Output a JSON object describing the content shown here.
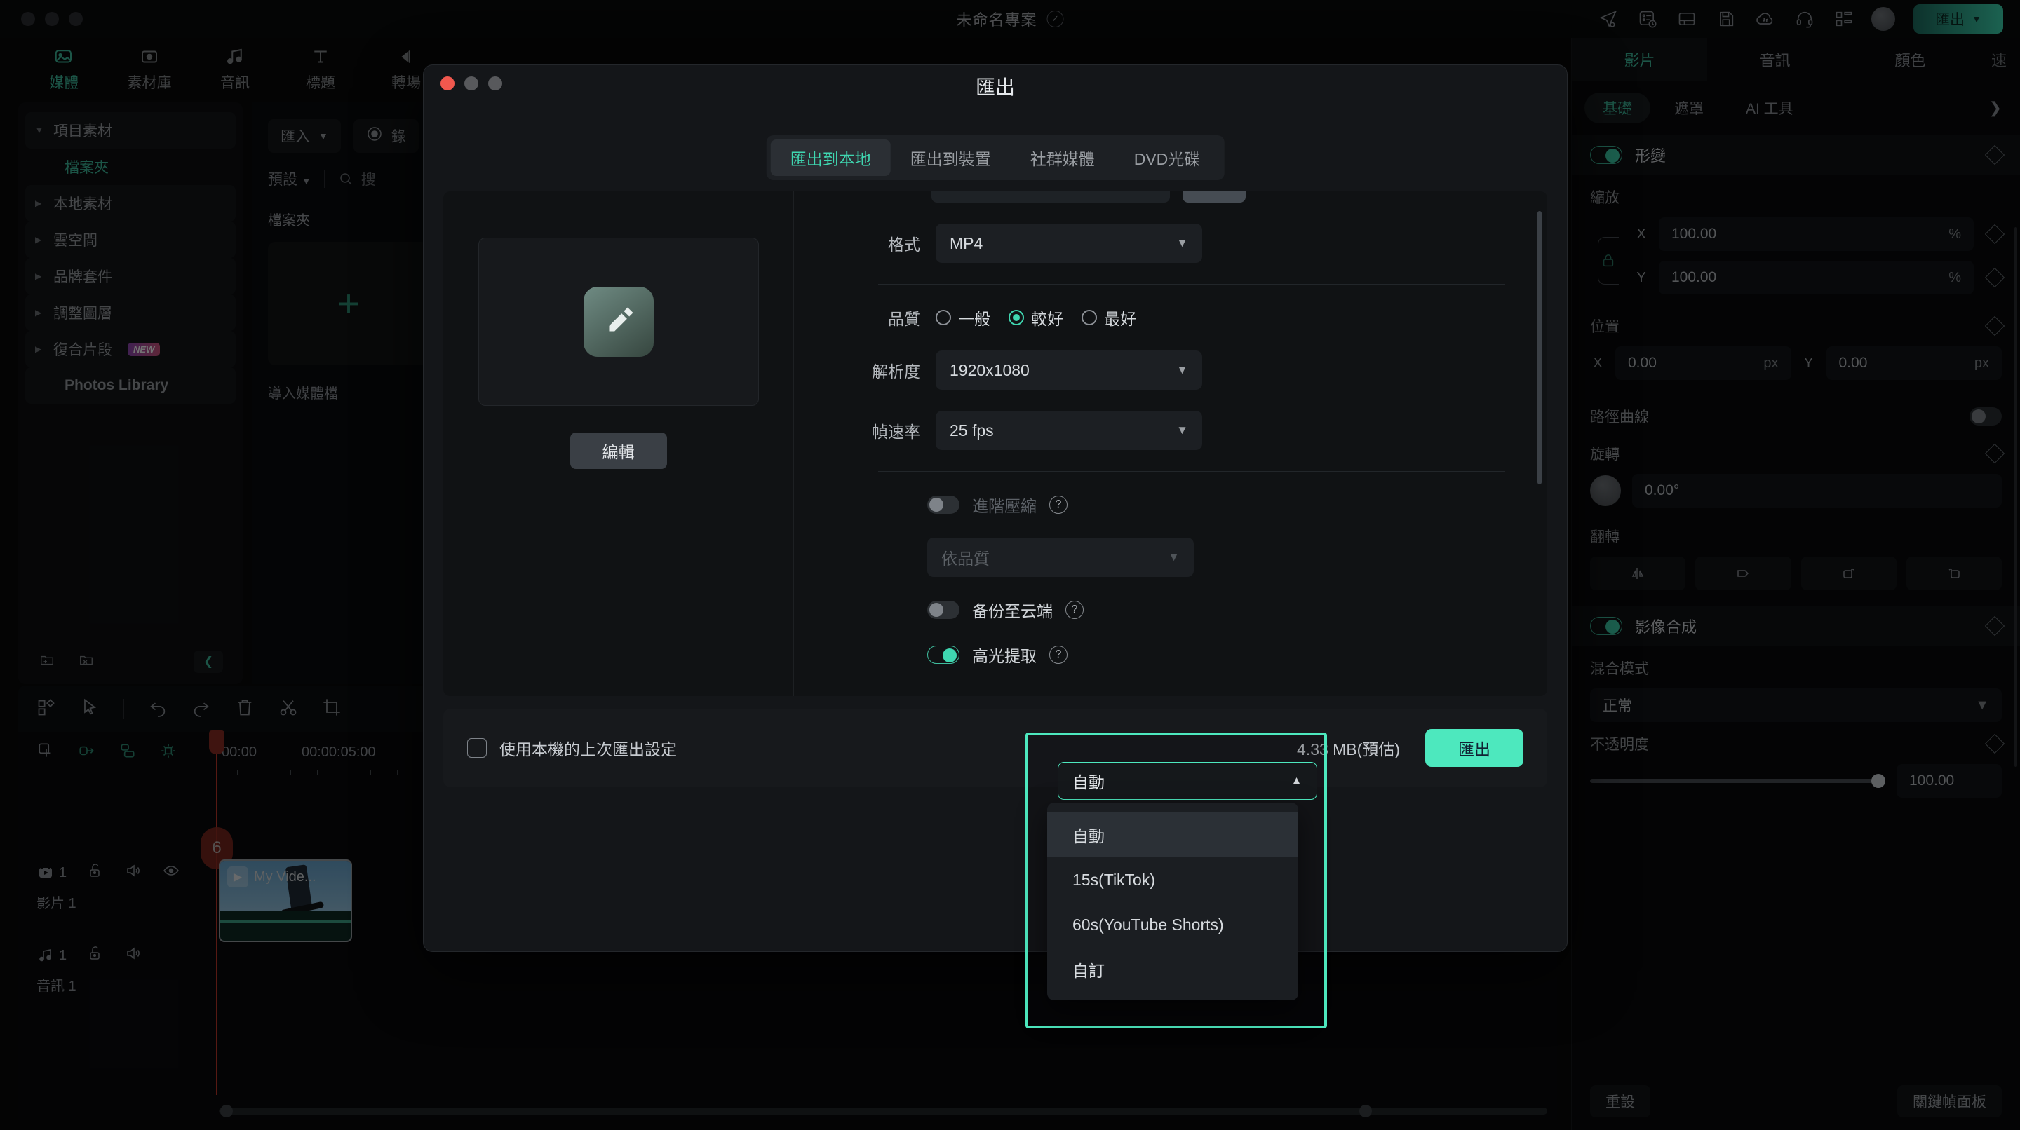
{
  "topbar": {
    "project_title": "未命名專案",
    "export_label": "匯出",
    "icons": [
      "send-icon",
      "task-list-icon",
      "layout-icon",
      "save-icon",
      "cloud-sync-icon",
      "headset-icon",
      "grid-icon"
    ]
  },
  "leftnav": {
    "tabs": [
      {
        "label": "媒體",
        "icon": "media-icon",
        "active": true
      },
      {
        "label": "素材庫",
        "icon": "stock-library-icon",
        "active": false
      },
      {
        "label": "音訊",
        "icon": "audio-icon",
        "active": false
      },
      {
        "label": "標題",
        "icon": "title-icon",
        "active": false
      },
      {
        "label": "轉場",
        "icon": "transition-icon",
        "active": false
      }
    ]
  },
  "leftpanel": {
    "items": [
      {
        "label": "項目素材",
        "caret": "down",
        "highlight": true,
        "sub": false
      },
      {
        "label": "檔案夾",
        "caret": "none",
        "highlight": false,
        "sub": true
      },
      {
        "label": "本地素材",
        "caret": "right",
        "highlight": true,
        "sub": false
      },
      {
        "label": "雲空間",
        "caret": "right",
        "highlight": true,
        "sub": false
      },
      {
        "label": "品牌套件",
        "caret": "right",
        "highlight": true,
        "sub": false
      },
      {
        "label": "調整圖層",
        "caret": "right",
        "highlight": true,
        "sub": false
      },
      {
        "label": "復合片段",
        "caret": "right",
        "highlight": true,
        "sub": false,
        "badge": "NEW"
      },
      {
        "label": "Photos Library",
        "caret": "none",
        "highlight": true,
        "sub": false
      }
    ],
    "footer_icons": [
      "new-folder-icon",
      "delete-folder-icon",
      "collapse-icon"
    ]
  },
  "mediapanel": {
    "import_label": "匯入",
    "record_label": "錄",
    "preset_label": "預設",
    "search_placeholder": "搜",
    "folder_label": "檔案夾",
    "add_label": "+",
    "caption": "導入媒體檔"
  },
  "rightpanel": {
    "tabs": [
      {
        "label": "影片",
        "active": true
      },
      {
        "label": "音訊",
        "active": false
      },
      {
        "label": "顏色",
        "active": false
      },
      {
        "label": "速",
        "active": false
      }
    ],
    "subtabs": [
      {
        "label": "基礎",
        "active": true
      },
      {
        "label": "遮罩",
        "active": false
      },
      {
        "label": "AI 工具",
        "active": false
      }
    ],
    "transform": {
      "header": "形變",
      "header_toggle": "on",
      "scale_label": "縮放",
      "scale_x_axis": "X",
      "scale_x_value": "100.00",
      "scale_x_unit": "%",
      "scale_y_axis": "Y",
      "scale_y_value": "100.00",
      "scale_y_unit": "%",
      "position_label": "位置",
      "pos_x_axis": "X",
      "pos_x_value": "0.00",
      "pos_x_unit": "px",
      "pos_y_axis": "Y",
      "pos_y_value": "0.00",
      "pos_y_unit": "px",
      "path_curve_label": "路徑曲線",
      "path_curve_toggle": "off",
      "rotate_label": "旋轉",
      "rotate_value": "0.00°",
      "flip_label": "翻轉",
      "flip_buttons": [
        "flip-horizontal-icon",
        "flip-vertical-icon",
        "rotate-right-icon",
        "rotate-left-icon"
      ]
    },
    "compositing": {
      "header": "影像合成",
      "header_toggle": "on",
      "blend_label": "混合模式",
      "blend_value": "正常",
      "opacity_label": "不透明度",
      "opacity_value": "100.00"
    },
    "footer": {
      "reset_label": "重設",
      "keyframe_label": "關鍵幀面板"
    }
  },
  "timeline": {
    "toolbar_icons": [
      "templates-icon",
      "select-icon",
      "undo-icon",
      "redo-icon",
      "delete-icon",
      "split-icon",
      "crop-icon"
    ],
    "head_icons": [
      "duplicate-icon",
      "link-icon",
      "align-icon",
      "marker-icon"
    ],
    "ruler_labels": [
      "00:00",
      "00:00:05:00",
      "00:00"
    ],
    "playhead_badge": "6",
    "tracks": [
      {
        "icon": "video-track-icon",
        "number": "1",
        "name": "影片 1",
        "lock": "unlock-icon",
        "mute": "speaker-icon",
        "eye": "eye-icon"
      },
      {
        "icon": "audio-track-icon",
        "number": "1",
        "name": "音訊 1",
        "lock": "unlock-icon",
        "mute": "speaker-icon"
      }
    ],
    "clip_label": "My Vide..."
  },
  "dialog": {
    "title": "匯出",
    "tabs": [
      {
        "label": "匯出到本地",
        "active": true
      },
      {
        "label": "匯出到裝置",
        "active": false
      },
      {
        "label": "社群媒體",
        "active": false
      },
      {
        "label": "DVD光碟",
        "active": false
      }
    ],
    "preview": {
      "icon": "edit-pencil-icon",
      "edit_label": "編輯"
    },
    "fields": {
      "format_label": "格式",
      "format_value": "MP4",
      "quality_label": "品質",
      "quality_options": [
        {
          "label": "一般",
          "selected": false
        },
        {
          "label": "較好",
          "selected": true
        },
        {
          "label": "最好",
          "selected": false
        }
      ],
      "resolution_label": "解析度",
      "resolution_value": "1920x1080",
      "framerate_label": "幀速率",
      "framerate_value": "25 fps",
      "advanced_compress_label": "進階壓縮",
      "advanced_compress_toggle": "off",
      "compress_mode_value": "依品質",
      "cloud_backup_label": "备份至云端",
      "cloud_backup_toggle": "off",
      "highlight_extract_label": "高光提取",
      "highlight_extract_toggle": "on",
      "extra_toggle": "on"
    },
    "dropdown": {
      "selected": "自動",
      "options": [
        {
          "label": "自動",
          "highlighted": true
        },
        {
          "label": "15s(TikTok)",
          "highlighted": false
        },
        {
          "label": "60s(YouTube Shorts)",
          "highlighted": false
        },
        {
          "label": "自訂",
          "highlighted": false
        }
      ]
    },
    "footer": {
      "checkbox_label": "使用本機的上次匯出設定",
      "size_label": "4.33 MB(預估)",
      "export_label": "匯出"
    }
  },
  "colors": {
    "accent": "#4de8be",
    "accent_dim": "#3fbd9e",
    "bg": "#0a0a0b",
    "panel": "#101214"
  }
}
